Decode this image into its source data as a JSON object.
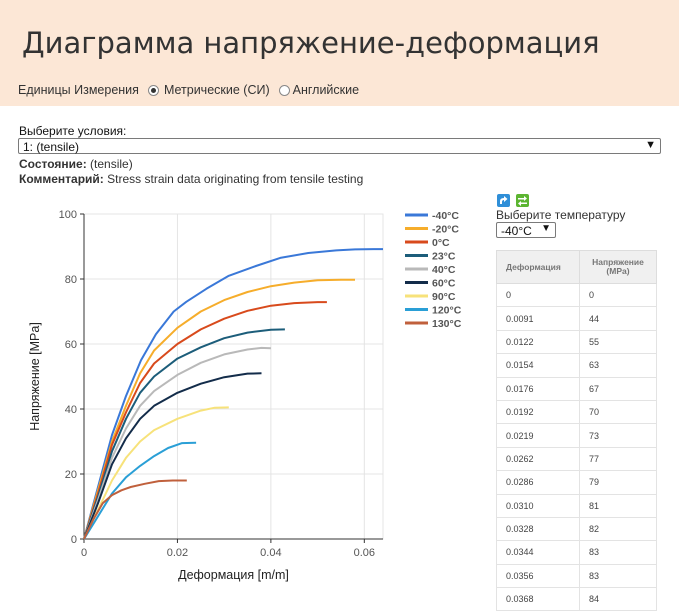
{
  "header": {
    "title": "Диаграмма напряжение-деформация",
    "units_label": "Единицы Измерения",
    "unit_metric": "Метрические (СИ)",
    "unit_english": "Английские",
    "selected_unit": "metric",
    "background": "#fce7d6"
  },
  "conditions": {
    "label": "Выберите условия:",
    "selected": "1: (tensile)",
    "state_label": "Состояние:",
    "state_value": "(tensile)",
    "comment_label": "Комментарий:",
    "comment_value": "Stress strain data originating from tensile testing"
  },
  "toolbar": {
    "export_icon": "share-arrow-icon",
    "table_icon": "swap-arrows-icon"
  },
  "temperature": {
    "label": "Выберите температуру",
    "selected": "-40°C"
  },
  "table": {
    "headers": [
      "Деформация",
      "Напряжение (MPa)"
    ],
    "rows": [
      [
        "0",
        "0"
      ],
      [
        "0.0091",
        "44"
      ],
      [
        "0.0122",
        "55"
      ],
      [
        "0.0154",
        "63"
      ],
      [
        "0.0176",
        "67"
      ],
      [
        "0.0192",
        "70"
      ],
      [
        "0.0219",
        "73"
      ],
      [
        "0.0262",
        "77"
      ],
      [
        "0.0286",
        "79"
      ],
      [
        "0.0310",
        "81"
      ],
      [
        "0.0328",
        "82"
      ],
      [
        "0.0344",
        "83"
      ],
      [
        "0.0356",
        "83"
      ],
      [
        "0.0368",
        "84"
      ]
    ]
  },
  "chart_data": {
    "type": "line",
    "title": "",
    "xlabel": "Деформация [m/m]",
    "ylabel": "Напряжение [MPa]",
    "xlim": [
      0,
      0.064
    ],
    "ylim": [
      0,
      100
    ],
    "xticks": [
      0,
      0.02,
      0.04,
      0.06
    ],
    "xtick_labels": [
      "0",
      "0.02",
      "0.04",
      "0.06"
    ],
    "yticks": [
      0,
      20,
      40,
      60,
      80,
      100
    ],
    "ytick_labels": [
      "0",
      "20",
      "40",
      "60",
      "80",
      "100"
    ],
    "grid": true,
    "legend_position": "right",
    "series": [
      {
        "name": "-40°C",
        "color": "#3a78d8",
        "x": [
          0,
          0.003,
          0.006,
          0.009,
          0.0122,
          0.0154,
          0.0192,
          0.0219,
          0.0262,
          0.031,
          0.0368,
          0.042,
          0.048,
          0.054,
          0.058,
          0.062,
          0.064
        ],
        "y": [
          0,
          16,
          32,
          44,
          55,
          63,
          70,
          73,
          77,
          81,
          84,
          86.5,
          88,
          88.8,
          89.1,
          89.2,
          89.2
        ]
      },
      {
        "name": "-20°C",
        "color": "#f6ad2b",
        "x": [
          0,
          0.003,
          0.006,
          0.009,
          0.012,
          0.015,
          0.02,
          0.025,
          0.03,
          0.035,
          0.04,
          0.045,
          0.05,
          0.055,
          0.058
        ],
        "y": [
          0,
          15,
          30,
          41,
          51,
          58,
          65,
          70,
          73.5,
          76,
          77.8,
          78.9,
          79.6,
          79.8,
          79.8
        ]
      },
      {
        "name": "0°C",
        "color": "#d84a1c",
        "x": [
          0,
          0.003,
          0.006,
          0.009,
          0.012,
          0.015,
          0.02,
          0.025,
          0.03,
          0.035,
          0.04,
          0.045,
          0.05,
          0.052
        ],
        "y": [
          0,
          14,
          29,
          39,
          48,
          54,
          60,
          64.5,
          67.8,
          70.2,
          71.8,
          72.6,
          72.9,
          72.9
        ]
      },
      {
        "name": "23°C",
        "color": "#1c5d7a",
        "x": [
          0,
          0.003,
          0.006,
          0.009,
          0.012,
          0.015,
          0.02,
          0.025,
          0.03,
          0.035,
          0.04,
          0.043
        ],
        "y": [
          0,
          13,
          27,
          37,
          45,
          50,
          55.5,
          59,
          61.8,
          63.5,
          64.4,
          64.5
        ]
      },
      {
        "name": "40°C",
        "color": "#b9b9b9",
        "x": [
          0,
          0.003,
          0.006,
          0.009,
          0.012,
          0.015,
          0.02,
          0.025,
          0.03,
          0.035,
          0.038,
          0.04
        ],
        "y": [
          0,
          12,
          25,
          34,
          41,
          45.5,
          50.5,
          54.2,
          56.8,
          58.3,
          58.8,
          58.7
        ]
      },
      {
        "name": "60°C",
        "color": "#132c4a",
        "x": [
          0,
          0.003,
          0.006,
          0.009,
          0.012,
          0.015,
          0.02,
          0.025,
          0.03,
          0.035,
          0.038
        ],
        "y": [
          0,
          11,
          23,
          31,
          37,
          41,
          45,
          47.8,
          49.8,
          50.9,
          51
        ]
      },
      {
        "name": "90°C",
        "color": "#f7e27a",
        "x": [
          0,
          0.003,
          0.006,
          0.009,
          0.012,
          0.015,
          0.02,
          0.025,
          0.028,
          0.031
        ],
        "y": [
          0,
          9,
          18,
          25,
          30,
          33.5,
          37,
          39.5,
          40.4,
          40.5
        ]
      },
      {
        "name": "120°C",
        "color": "#2a9fd6",
        "x": [
          0,
          0.003,
          0.006,
          0.009,
          0.012,
          0.015,
          0.018,
          0.021,
          0.024
        ],
        "y": [
          0,
          7,
          14,
          19,
          22.5,
          25.5,
          28,
          29.5,
          29.6
        ]
      },
      {
        "name": "130°C",
        "color": "#c0603c",
        "x": [
          0,
          0.002,
          0.004,
          0.006,
          0.008,
          0.01,
          0.013,
          0.016,
          0.019,
          0.022
        ],
        "y": [
          0,
          6,
          11,
          13.5,
          15,
          16,
          17,
          17.8,
          18,
          18
        ]
      }
    ]
  }
}
